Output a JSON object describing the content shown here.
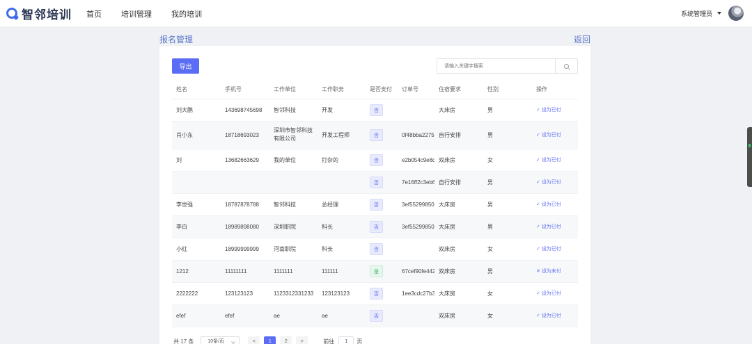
{
  "app": {
    "logo_text": "智邻培训"
  },
  "nav": {
    "items": [
      "首页",
      "培训管理",
      "我的培训"
    ]
  },
  "user": {
    "name": "系统管理员"
  },
  "page": {
    "title": "报名管理",
    "back_label": "返回"
  },
  "toolbar": {
    "export_label": "导出",
    "search_placeholder": "请输入关键字搜索"
  },
  "table": {
    "headers": [
      "姓名",
      "手机号",
      "工作单位",
      "工作职务",
      "是否支付",
      "订单号",
      "住宿要求",
      "性别",
      "操作"
    ],
    "rows": [
      {
        "name": "刘大鹏",
        "phone": "143698745698",
        "company": "智邻科技",
        "position": "开发",
        "paid": "否",
        "order": "",
        "lodging": "大床房",
        "gender": "男",
        "action": "设为已付"
      },
      {
        "name": "肖小东",
        "phone": "18718693023",
        "company": "深圳市智邻科技有限公司",
        "position": "开发工程师",
        "paid": "否",
        "order": "0f48bba2275e",
        "lodging": "自行安排",
        "gender": "男",
        "action": "设为已付"
      },
      {
        "name": "刘",
        "phone": "13682663629",
        "company": "我的单位",
        "position": "打杂的",
        "paid": "否",
        "order": "e2b054c9e8d",
        "lodging": "双床房",
        "gender": "女",
        "action": "设为已付"
      },
      {
        "name": "",
        "phone": "",
        "company": "",
        "position": "",
        "paid": "否",
        "order": "7e16ff2c3eb6",
        "lodging": "自行安排",
        "gender": "男",
        "action": "设为已付"
      },
      {
        "name": "李世强",
        "phone": "18787878788",
        "company": "智邻科技",
        "position": "总经理",
        "paid": "否",
        "order": "3ef552998503",
        "lodging": "大床房",
        "gender": "男",
        "action": "设为已付"
      },
      {
        "name": "李白",
        "phone": "18989898080",
        "company": "深圳职院",
        "position": "科长",
        "paid": "否",
        "order": "3ef552998503",
        "lodging": "大床房",
        "gender": "男",
        "action": "设为已付"
      },
      {
        "name": "小红",
        "phone": "18999999999",
        "company": "河南职院",
        "position": "科长",
        "paid": "否",
        "order": "",
        "lodging": "双床房",
        "gender": "女",
        "action": "设为已付"
      },
      {
        "name": "1212",
        "phone": "11111111",
        "company": "1111111",
        "position": "111111",
        "paid": "是",
        "order": "67cef90fe442",
        "lodging": "双床房",
        "gender": "男",
        "action": "设为未付"
      },
      {
        "name": "2222222",
        "phone": "123123123",
        "company": "1123312331233",
        "position": "123123123",
        "paid": "否",
        "order": "1ee3cdc27b3",
        "lodging": "大床房",
        "gender": "女",
        "action": "设为已付"
      },
      {
        "name": "efef",
        "phone": "efef",
        "company": "ae",
        "position": "ae",
        "paid": "否",
        "order": "",
        "lodging": "双床房",
        "gender": "女",
        "action": "设为已付"
      }
    ]
  },
  "pagination": {
    "total": "共 17 条",
    "page_size": "10条/页",
    "prev": "<",
    "pages": [
      "1",
      "2"
    ],
    "next": ">",
    "goto_label": "前往",
    "goto_value": "1",
    "goto_suffix": "页"
  },
  "colors": {
    "accent": "#5b6cf5",
    "link": "#5a78c9",
    "paid_green": "#36b36a"
  },
  "icons": {
    "search": "search-icon",
    "action_confirm": "check-icon",
    "action_revert": "cross-icon",
    "user_menu": "caret-down-icon"
  }
}
